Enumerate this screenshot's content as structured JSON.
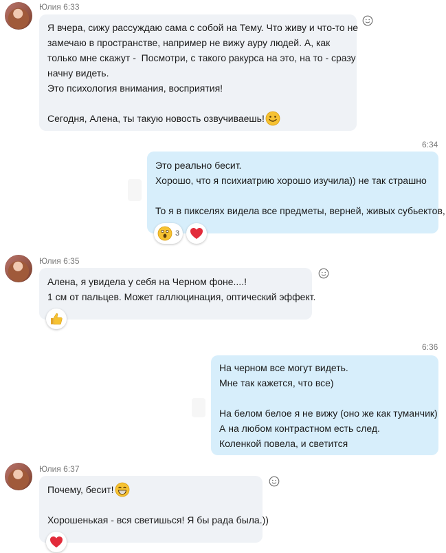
{
  "colors": {
    "incoming_bubble": "#eff2f6",
    "outgoing_bubble": "#d7eefb",
    "heart": "#e22b3a",
    "emoji_yellow": "#f6c232"
  },
  "messages": [
    {
      "author": "Юлия",
      "time": "6:33",
      "lines": [
        "Я вчера, сижу рассуждаю сама с собой на Тему. Что живу и что-то не",
        "замечаю в пространстве, например не вижу ауру людей. А, как",
        "только мне скажут -  Посмотри, с такого ракурса на это, на то - сразу",
        "начну видеть.",
        "Это психология внимания, восприятия!",
        "",
        "Сегодня, Алена, ты такую новость озвучиваешь!"
      ],
      "trailing_emoji": "smile-emoji"
    },
    {
      "time": "6:34",
      "lines": [
        "Это реально бесит.",
        "Хорошо, что я психиатрию хорошо изучила)) не так страшно",
        "",
        "То я в пикселях видела все предметы, верней, живых субьектов,"
      ],
      "reactions": [
        {
          "icon": "astonished-emoji",
          "count": "3"
        },
        {
          "icon": "heart-icon",
          "count": ""
        }
      ]
    },
    {
      "author": "Юлия",
      "time": "6:35",
      "lines": [
        "Алена, я увидела у себя на Черном фоне....!",
        "1 см от пальцев. Может галлюцинация, оптический эффект."
      ],
      "reactions": [
        {
          "icon": "thumbs-up-icon",
          "count": ""
        }
      ]
    },
    {
      "time": "6:36",
      "lines": [
        "На черном все могут видеть.",
        "Мне так кажется, что все)",
        "",
        "На белом белое я не вижу (оно же как туманчик)",
        "А на любом контрастном есть след.",
        "Коленкой повела, и светится"
      ]
    },
    {
      "author": "Юлия",
      "time": "6:37",
      "lines": [
        "Почему, бесит!",
        "",
        "Хорошенькая - вся светишься! Я бы рада была.))"
      ],
      "first_line_emoji": "grin-emoji",
      "reactions": [
        {
          "icon": "heart-icon",
          "count": ""
        }
      ]
    }
  ]
}
